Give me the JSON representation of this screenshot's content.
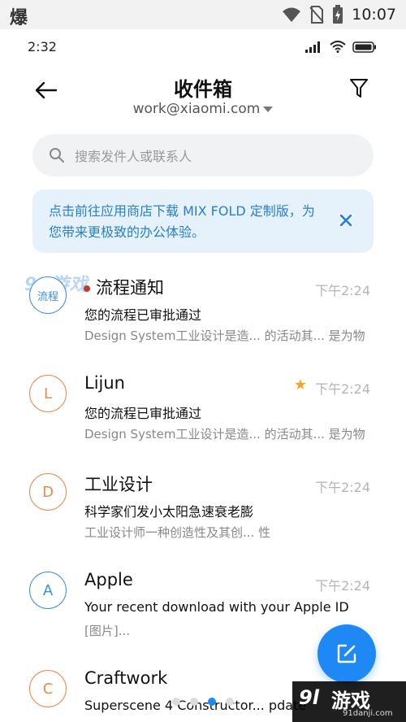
{
  "outer_status": {
    "left_glyph": "爆",
    "time": "10:07"
  },
  "inner_status": {
    "time": "2:32"
  },
  "header": {
    "title": "收件箱",
    "account": "work@xiaomi.com"
  },
  "search": {
    "placeholder": "搜索发件人或联系人"
  },
  "banner": {
    "text": "点击前往应用商店下载 MIX FOLD 定制版，为您带来更极致的办公体验。"
  },
  "mails": [
    {
      "avatar": "流程",
      "avatar_color": "#3d8fd9",
      "sender": "流程通知",
      "unread": true,
      "starred": false,
      "time": "下午2:24",
      "subject": "您的流程已审批通过",
      "preview": "Design System工业设计是造... 的活动其... 是为物"
    },
    {
      "avatar": "L",
      "avatar_color": "#e8894a",
      "sender": "Lijun",
      "unread": false,
      "starred": true,
      "time": "下午2:24",
      "subject": "您的流程已审批通过",
      "preview": "Design System工业设计是造... 的活动其... 是为物"
    },
    {
      "avatar": "D",
      "avatar_color": "#e8894a",
      "sender": "工业设计",
      "unread": false,
      "starred": false,
      "time": "下午2:24",
      "subject": "科学家们发小太阳急速衰老膨",
      "preview": "工业设计师一种创造性及其创... 性"
    },
    {
      "avatar": "A",
      "avatar_color": "#3d8fd9",
      "sender": "Apple",
      "unread": false,
      "starred": false,
      "time": "下午2:24",
      "subject": "Your recent download with  your Apple ID",
      "preview": "[图片]..."
    },
    {
      "avatar": "C",
      "avatar_color": "#e8894a",
      "sender": "Craftwork",
      "unread": false,
      "starred": false,
      "time": "",
      "subject": "Superscene 4 Constructor... pdate",
      "preview": ""
    }
  ],
  "pager": {
    "count": 4,
    "active": 2
  },
  "watermarks": {
    "top": "91游戏",
    "bottom_big": "游戏",
    "bottom_num": "9l",
    "bottom_small": "91danji.com"
  }
}
